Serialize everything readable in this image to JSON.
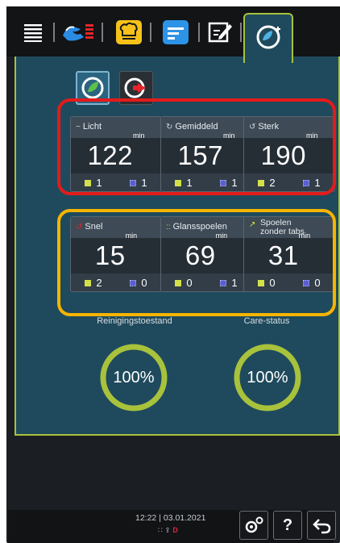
{
  "tabs": [
    {
      "icon": "list-icon"
    },
    {
      "icon": "hands-care-icon"
    },
    {
      "icon": "chef-hat-icon"
    },
    {
      "icon": "program-list-icon"
    },
    {
      "icon": "edit-icon"
    },
    {
      "icon": "care-cleaning-icon",
      "active": true
    }
  ],
  "mode_buttons": [
    {
      "icon": "eco-cleaning-icon",
      "selected": true
    },
    {
      "icon": "express-cleaning-icon",
      "selected": false
    }
  ],
  "programs_row1": [
    {
      "name": "Licht",
      "icon": "~",
      "time": "122",
      "unit": "min",
      "tabs_yellow": "1",
      "tabs_blue": "1"
    },
    {
      "name": "Gemiddeld",
      "icon": "↻",
      "time": "157",
      "unit": "min",
      "tabs_yellow": "1",
      "tabs_blue": "1"
    },
    {
      "name": "Sterk",
      "icon": "↺",
      "time": "190",
      "unit": "min",
      "tabs_yellow": "2",
      "tabs_blue": "1"
    }
  ],
  "programs_row2": [
    {
      "name": "Snel",
      "icon": "↺",
      "time": "15",
      "unit": "min",
      "tabs_yellow": "2",
      "tabs_blue": "0"
    },
    {
      "name": "Glansspoelen",
      "icon": "::",
      "time": "69",
      "unit": "min",
      "tabs_yellow": "0",
      "tabs_blue": "1"
    },
    {
      "name_line1": "Spoelen",
      "name_line2": "zonder tabs",
      "icon": "↗",
      "time": "31",
      "unit": "min",
      "tabs_yellow": "0",
      "tabs_blue": "0"
    }
  ],
  "gauges": {
    "cleaning_label": "Reinigingstoestand",
    "cleaning_value": "100%",
    "cleaning_fraction": 1.0,
    "care_label": "Care-status",
    "care_value": "100%",
    "care_fraction": 1.0
  },
  "footer": {
    "time": "12:22",
    "separator": "|",
    "date": "03.01.2021",
    "network": "∷",
    "usb": "⇪",
    "d_badge": "D",
    "settings_icon": "settings-icon",
    "help_label": "?",
    "back_icon": "back-arrow-icon"
  },
  "colors": {
    "panel": "#1f4a5d",
    "accent_green": "#a8c23c",
    "highlight_red": "#e31b1b",
    "highlight_orange": "#f6b400",
    "tab_yellow": "#d4e04a",
    "tab_blue": "#5a5fd0"
  }
}
